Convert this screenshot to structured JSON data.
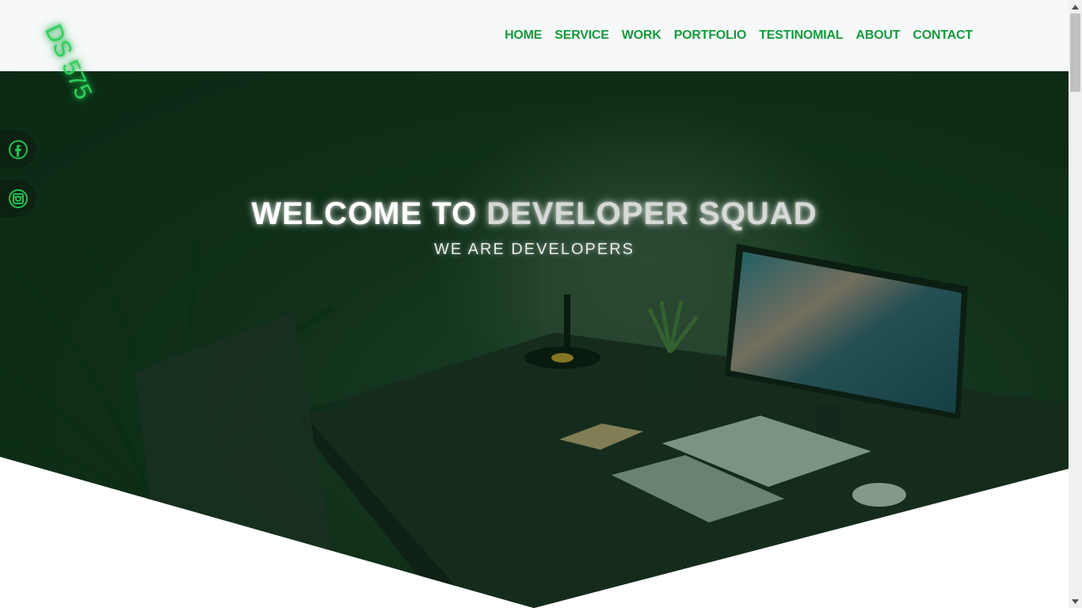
{
  "header": {
    "logo_text": "DS 575",
    "nav": [
      "HOME",
      "SERVICE",
      "WORK",
      "PORTFOLIO",
      "TESTINOMIAL",
      "ABOUT",
      "CONTACT"
    ]
  },
  "hero": {
    "title_part1": "WELCOME TO ",
    "title_part2": "DEVELOPER SQUAD",
    "subtitle": "WE ARE DEVELOPERS"
  },
  "social": [
    {
      "icon": "facebook-icon"
    },
    {
      "icon": "instagram-icon"
    }
  ],
  "colors": {
    "accent": "#159a3c",
    "hero_overlay": "#0c2614",
    "header_bg": "#f6f8f9"
  }
}
